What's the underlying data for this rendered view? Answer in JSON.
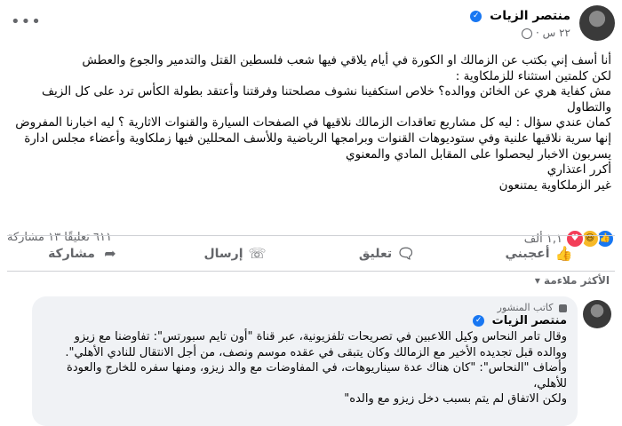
{
  "post": {
    "author": "منتصر الزيات",
    "time": "٢٢ س ·",
    "body": [
      "أنا أسف إني بكتب عن الزمالك او الكورة في أيام يلاقي فيها شعب فلسطين القتل والتدمير والجوع والعطش",
      "لكن كلمتين استثناء للزملكاوية :",
      "مش كفاية هري عن الخائن ووالده؟ خلاص استكفينا نشوف مصلحتنا وفرقتنا وأعتقد بطولة الكأس ترد على كل الزيف والتطاول",
      "كمان عندي سؤال : ليه كل مشاريع تعاقدات الزمالك نلاقيها في الصفحات السيارة والقنوات الاثارية ؟ ليه اخبارنا المفروض إنها سرية نلاقيها علنية وفي ستوديوهات القنوات وبرامجها الرياضية وللأسف المحللين فيها زملكاوية وأعضاء مجلس ادارة يسربون الاخبار ليحصلوا على المقابل المادي والمعنوي",
      "أكرر اعتذاري",
      "غير الزملكاوية يمتنعون"
    ]
  },
  "counts": {
    "reactions": "١,١ ألف",
    "comments_shares": "٦١١ تعليقًا  ١٣ مشاركة"
  },
  "actions": {
    "like": "أعجبني",
    "comment": "تعليق",
    "send": "إرسال",
    "share": "مشاركة"
  },
  "sort_label": "الأكثر ملاءمة ▾",
  "comment": {
    "badge": "كاتب المنشور",
    "author": "منتصر الزيات",
    "lines": [
      "وقال تامر النحاس وكيل اللاعبين في تصريحات تلفزيونية، عبر قناة \"أون تايم سبورتس\": تفاوضنا مع زيزو ووالده قبل تجديده الأخير مع الزمالك وكان يتبقى في عقده موسم ونصف، من أجل الانتقال للنادي الأهلي\".",
      "وأضاف \"النحاس\": \"كان هناك عدة سيناريوهات، في المفاوضات مع والد زيزو، ومنها سفره للخارج والعودة للأهلي،",
      "ولكن الاتفاق لم يتم بسبب دخل زيزو مع والده\""
    ]
  },
  "colors": {
    "accent": "#1877f2",
    "muted": "#65676b",
    "bubble": "#f0f2f5"
  }
}
